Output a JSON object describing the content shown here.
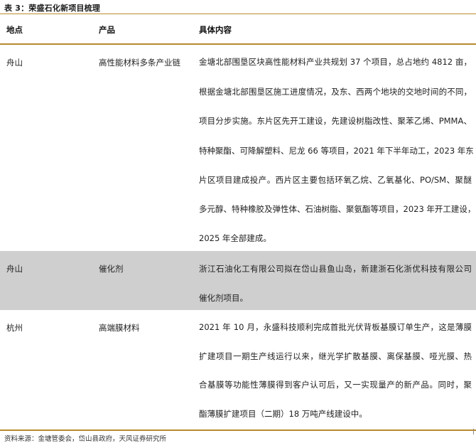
{
  "caption": "表 3：荣盛石化新项目梳理",
  "columns": [
    "地点",
    "产品",
    "具体内容"
  ],
  "rows": [
    {
      "location": "舟山",
      "product": "高性能材料多条产业链",
      "lines": [
        "金塘北部围垦区块高性能材料产业共规划 37 个项目，总占地约 4812 亩，",
        "根据金塘北部围垦区施工进度情况，及东、西两个地块的交地时间的不同，",
        "项目分步实施。东片区先开工建设，先建设树脂改性、聚苯乙烯、PMMA、",
        "特种聚酯、可降解塑料、尼龙 66 等项目，2021 年下半年动工，2023 年东",
        "片区项目建成投产。西片区主要包括环氧乙烷、乙氧基化、PO/SM、聚醚",
        "多元醇、特种橡胶及弹性体、石油树脂、聚氨酯等项目，2023 年开工建设，",
        "2025 年全部建成。"
      ]
    },
    {
      "location": "舟山",
      "product": "催化剂",
      "lines": [
        "浙江石油化工有限公司拟在岱山县鱼山岛，新建浙石化浙优科技有限公司",
        "催化剂项目。"
      ]
    },
    {
      "location": "杭州",
      "product": "高端膜材料",
      "lines": [
        "2021 年 10 月，永盛科技顺利完成首批光伏背板基膜订单生产，这是薄膜",
        "扩建项目一期生产线运行以来，继光学扩散基膜、离保基膜、哑光膜、热",
        "合基膜等功能性薄膜得到客户认可后，又一实现量产的新产品。同时，聚",
        "酯薄膜扩建项目（二期）18 万吨产线建设中。"
      ]
    }
  ],
  "footnote": "资料来源：金塘管委会，岱山县政府，天风证券研究所",
  "colors": {
    "accent_rule": "#b98a2e",
    "shaded_row": "#cfcfcf"
  }
}
